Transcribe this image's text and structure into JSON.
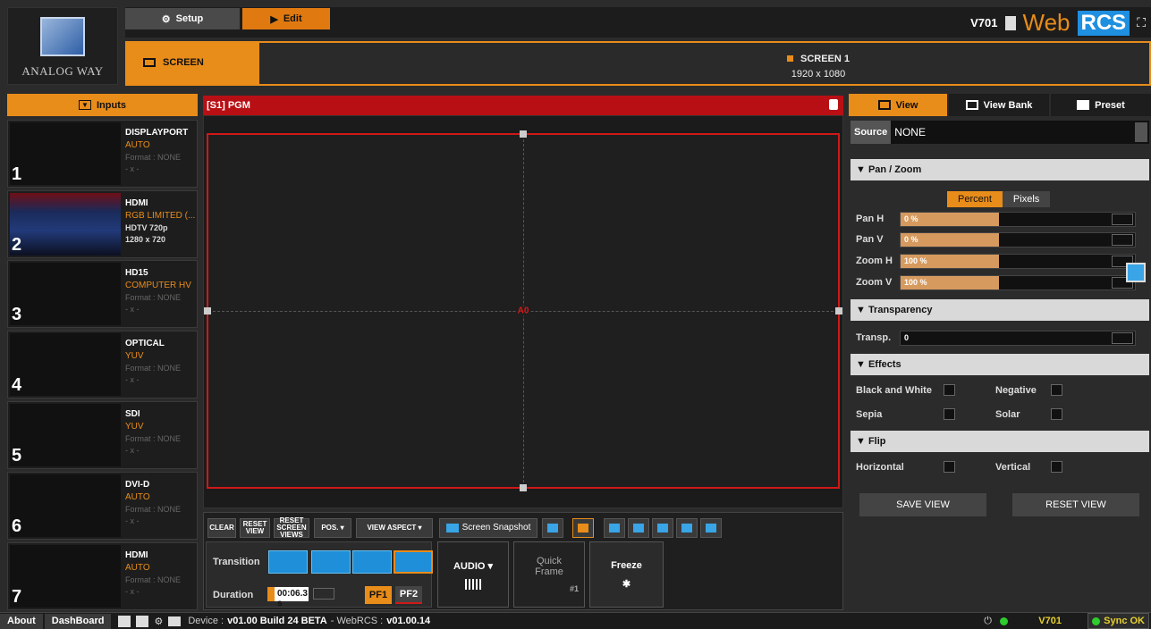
{
  "header": {
    "logo_text": "ANALOG WAY",
    "tabs": [
      {
        "label": "Setup"
      },
      {
        "label": "Edit"
      }
    ],
    "screen_label": "SCREEN",
    "screen_name": "SCREEN 1",
    "screen_res": "1920 x 1080",
    "version": "V701",
    "brand_web": "Web",
    "brand_rcs": "RCS"
  },
  "inputs": {
    "title": "Inputs",
    "items": [
      {
        "num": "1",
        "name": "DISPLAYPORT",
        "mode": "AUTO",
        "format": "Format : NONE",
        "res": "- x -"
      },
      {
        "num": "2",
        "name": "HDMI",
        "mode": "RGB LIMITED (...",
        "format": "HDTV 720p",
        "res": "1280 x 720"
      },
      {
        "num": "3",
        "name": "HD15",
        "mode": "COMPUTER HV",
        "format": "Format : NONE",
        "res": "- x -"
      },
      {
        "num": "4",
        "name": "OPTICAL",
        "mode": "YUV",
        "format": "Format : NONE",
        "res": "- x -"
      },
      {
        "num": "5",
        "name": "SDI",
        "mode": "YUV",
        "format": "Format : NONE",
        "res": "- x -"
      },
      {
        "num": "6",
        "name": "DVI-D",
        "mode": "AUTO",
        "format": "Format : NONE",
        "res": "- x -"
      },
      {
        "num": "7",
        "name": "HDMI",
        "mode": "AUTO",
        "format": "Format : NONE",
        "res": "- x -"
      }
    ]
  },
  "pgm": {
    "title": "[S1] PGM",
    "layer": "A0"
  },
  "toolbar": {
    "clear": "CLEAR",
    "reset_view": "RESET VIEW",
    "reset_screen_views": "RESET SCREEN VIEWS",
    "pos": "POS. ▾",
    "view_aspect": "VIEW ASPECT ▾",
    "snapshot": "Screen Snapshot",
    "transition": "Transition",
    "duration": "Duration",
    "duration_value": "00:06.3 s",
    "pf1": "PF1",
    "pf2": "PF2",
    "audio": "AUDIO ▾",
    "quick_frame": "Quick Frame",
    "quick_frame_num": "#1",
    "freeze": "Freeze"
  },
  "right": {
    "tabs": [
      {
        "label": "View"
      },
      {
        "label": "View Bank"
      },
      {
        "label": "Preset"
      }
    ],
    "source_label": "Source",
    "source_value": "NONE",
    "panzoom": "▼ Pan / Zoom",
    "percent": "Percent",
    "pixels": "Pixels",
    "sliders": [
      {
        "label": "Pan H",
        "value": "0 %"
      },
      {
        "label": "Pan V",
        "value": "0 %"
      },
      {
        "label": "Zoom H",
        "value": "100 %"
      },
      {
        "label": "Zoom V",
        "value": "100 %"
      }
    ],
    "transparency": "▼ Transparency",
    "transp_label": "Transp.",
    "transp_value": "0",
    "effects": "▼ Effects",
    "bw": "Black and White",
    "negative": "Negative",
    "sepia": "Sepia",
    "solar": "Solar",
    "flip": "▼ Flip",
    "horizontal": "Horizontal",
    "vertical": "Vertical",
    "save_view": "SAVE VIEW",
    "reset_view": "RESET VIEW"
  },
  "status": {
    "about": "About",
    "dashboard": "DashBoard",
    "device_label": "Device :",
    "device_ver": "v01.00 Build 24 BETA",
    "webrcs_label": "- WebRCS :",
    "webrcs_ver": "v01.00.14",
    "device_name": "V701",
    "sync": "Sync OK"
  }
}
